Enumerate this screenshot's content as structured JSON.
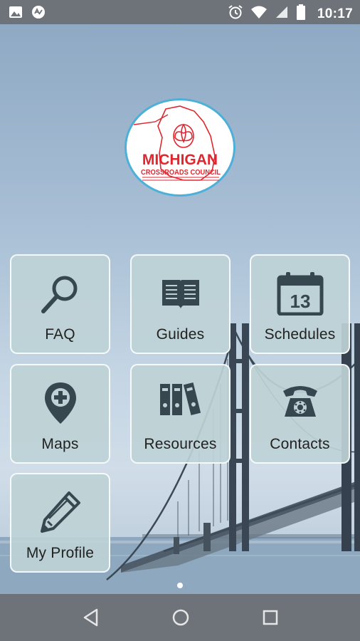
{
  "status_bar": {
    "time": "10:17",
    "left_icons": [
      "image-icon",
      "android-icon"
    ],
    "right_icons": [
      "alarm-icon",
      "wifi-icon",
      "signal-icon",
      "battery-icon"
    ]
  },
  "logo": {
    "name": "MICHIGAN",
    "tagline": "CROSSROADS COUNCIL",
    "brand_color": "#e0262f",
    "ring_color": "#4db0d8"
  },
  "tiles": [
    {
      "label": "FAQ",
      "icon": "search-icon"
    },
    {
      "label": "Guides",
      "icon": "book-icon"
    },
    {
      "label": "Schedules",
      "icon": "calendar-icon",
      "icon_text": "13"
    },
    {
      "label": "Maps",
      "icon": "map-pin-icon"
    },
    {
      "label": "Resources",
      "icon": "binders-icon"
    },
    {
      "label": "Contacts",
      "icon": "telephone-icon"
    },
    {
      "label": "My Profile",
      "icon": "pencil-icon"
    }
  ],
  "colors": {
    "icon": "#37474f",
    "tile_bg": "#bed2d6",
    "system_bar": "#6e7379"
  },
  "nav_bar": {
    "buttons": [
      "back-icon",
      "home-icon",
      "recents-icon"
    ]
  }
}
